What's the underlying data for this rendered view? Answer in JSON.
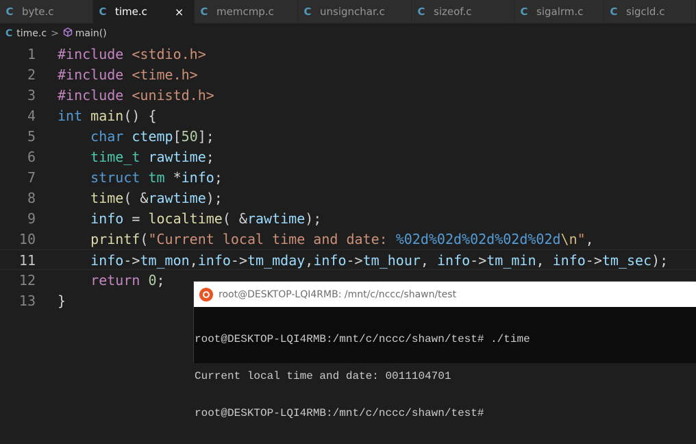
{
  "tabs": [
    {
      "label": "byte.c",
      "icon": "c-file-icon"
    },
    {
      "label": "time.c",
      "icon": "c-file-icon",
      "active": true
    },
    {
      "label": "memcmp.c",
      "icon": "c-file-icon"
    },
    {
      "label": "unsignchar.c",
      "icon": "c-file-icon"
    },
    {
      "label": "sizeof.c",
      "icon": "c-file-icon"
    },
    {
      "label": "sigalrm.c",
      "icon": "c-file-icon"
    },
    {
      "label": "sigcld.c",
      "icon": "c-file-icon"
    }
  ],
  "tab_icon_glyph": "C",
  "close_glyph": "×",
  "breadcrumb": {
    "file": "time.c",
    "separator": ">",
    "symbol": "main()"
  },
  "editor": {
    "current_line": 11,
    "lines": [
      {
        "n": "1",
        "tokens": [
          [
            "kw2",
            "#include "
          ],
          [
            "str",
            "<stdio.h>"
          ]
        ]
      },
      {
        "n": "2",
        "tokens": [
          [
            "kw2",
            "#include "
          ],
          [
            "str",
            "<time.h>"
          ]
        ]
      },
      {
        "n": "3",
        "tokens": [
          [
            "kw2",
            "#include "
          ],
          [
            "str",
            "<unistd.h>"
          ]
        ]
      },
      {
        "n": "4",
        "tokens": [
          [
            "kw",
            "int "
          ],
          [
            "fn",
            "main"
          ],
          [
            "pl",
            "() {"
          ]
        ]
      },
      {
        "n": "5",
        "tokens": [
          [
            "pl",
            "    "
          ],
          [
            "kw",
            "char "
          ],
          [
            "var",
            "ctemp"
          ],
          [
            "pl",
            "["
          ],
          [
            "num",
            "50"
          ],
          [
            "pl",
            "];"
          ]
        ]
      },
      {
        "n": "6",
        "tokens": [
          [
            "pl",
            "    "
          ],
          [
            "type",
            "time_t "
          ],
          [
            "var",
            "rawtime"
          ],
          [
            "pl",
            ";"
          ]
        ]
      },
      {
        "n": "7",
        "tokens": [
          [
            "pl",
            "    "
          ],
          [
            "kw",
            "struct "
          ],
          [
            "type",
            "tm "
          ],
          [
            "pl",
            "*"
          ],
          [
            "var",
            "info"
          ],
          [
            "pl",
            ";"
          ]
        ]
      },
      {
        "n": "8",
        "tokens": [
          [
            "pl",
            "    "
          ],
          [
            "fn",
            "time"
          ],
          [
            "pl",
            "( &"
          ],
          [
            "var",
            "rawtime"
          ],
          [
            "pl",
            ");"
          ]
        ]
      },
      {
        "n": "9",
        "tokens": [
          [
            "pl",
            "    "
          ],
          [
            "var",
            "info"
          ],
          [
            "pl",
            " = "
          ],
          [
            "fn",
            "localtime"
          ],
          [
            "pl",
            "( &"
          ],
          [
            "var",
            "rawtime"
          ],
          [
            "pl",
            ");"
          ]
        ]
      },
      {
        "n": "10",
        "tokens": [
          [
            "pl",
            "    "
          ],
          [
            "fn",
            "printf"
          ],
          [
            "pl",
            "("
          ],
          [
            "str",
            "\"Current local time and date: "
          ],
          [
            "fmt",
            "%02d%02d%02d%02d%02d"
          ],
          [
            "esc",
            "\\n"
          ],
          [
            "str",
            "\""
          ],
          [
            "pl",
            ","
          ]
        ]
      },
      {
        "n": "11",
        "tokens": [
          [
            "pl",
            "    "
          ],
          [
            "var",
            "info"
          ],
          [
            "pl",
            "->"
          ],
          [
            "var",
            "tm_mon"
          ],
          [
            "pl",
            ","
          ],
          [
            "var",
            "info"
          ],
          [
            "pl",
            "->"
          ],
          [
            "var",
            "tm_mday"
          ],
          [
            "pl",
            ","
          ],
          [
            "var",
            "info"
          ],
          [
            "pl",
            "->"
          ],
          [
            "var",
            "tm_hour"
          ],
          [
            "pl",
            ", "
          ],
          [
            "var",
            "info"
          ],
          [
            "pl",
            "->"
          ],
          [
            "var",
            "tm_min"
          ],
          [
            "pl",
            ", "
          ],
          [
            "var",
            "info"
          ],
          [
            "pl",
            "->"
          ],
          [
            "var",
            "tm_sec"
          ],
          [
            "pl",
            ");"
          ]
        ]
      },
      {
        "n": "12",
        "tokens": [
          [
            "pl",
            "    "
          ],
          [
            "kw2",
            "return "
          ],
          [
            "num",
            "0"
          ],
          [
            "pl",
            ";"
          ]
        ]
      },
      {
        "n": "13",
        "tokens": [
          [
            "pl",
            "}"
          ]
        ]
      }
    ]
  },
  "terminal": {
    "title": "root@DESKTOP-LQI4RMB: /mnt/c/nccc/shawn/test",
    "icon": "ubuntu-icon",
    "lines": [
      "root@DESKTOP-LQI4RMB:/mnt/c/nccc/shawn/test# ./time",
      "Current local time and date: 0011104701",
      "root@DESKTOP-LQI4RMB:/mnt/c/nccc/shawn/test#"
    ]
  },
  "colors": {
    "editor_bg": "#1e1e1e",
    "c_icon": "#519aba",
    "keyword": "#569cd6",
    "control": "#c586c0",
    "string": "#ce9178",
    "type": "#4ec9b0",
    "function": "#dcdcaa",
    "variable": "#9cdcfe",
    "number": "#b5cea8"
  }
}
